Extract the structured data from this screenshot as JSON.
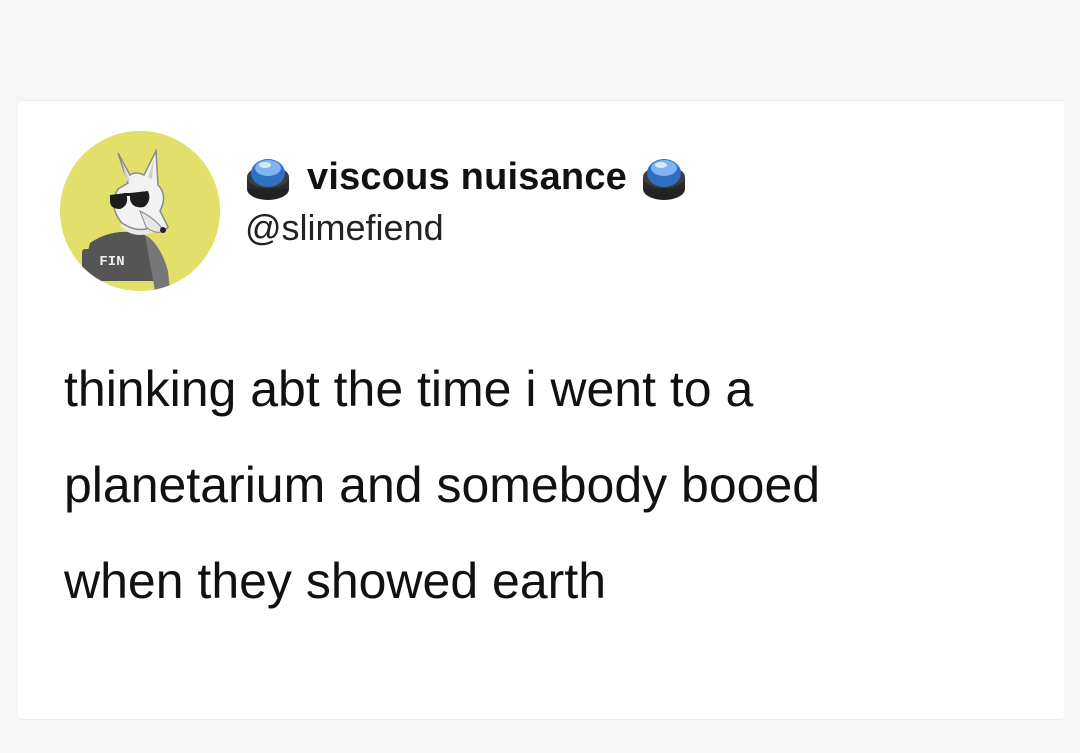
{
  "tweet": {
    "display_name": "viscous nuisance",
    "username": "@slimefiend",
    "name_emoji": "button-emoji-icon",
    "avatar_icon": "wolf-with-sunglasses-avatar",
    "avatar_shirt_text": "FIN",
    "text_lines": [
      "thinking abt the time i went to a",
      "planetarium and somebody booed",
      "when they showed earth"
    ]
  },
  "colors": {
    "page_bg": "#f6f6f6",
    "card_bg": "#ffffff",
    "avatar_bg": "#e3df6b",
    "text": "#111111"
  }
}
